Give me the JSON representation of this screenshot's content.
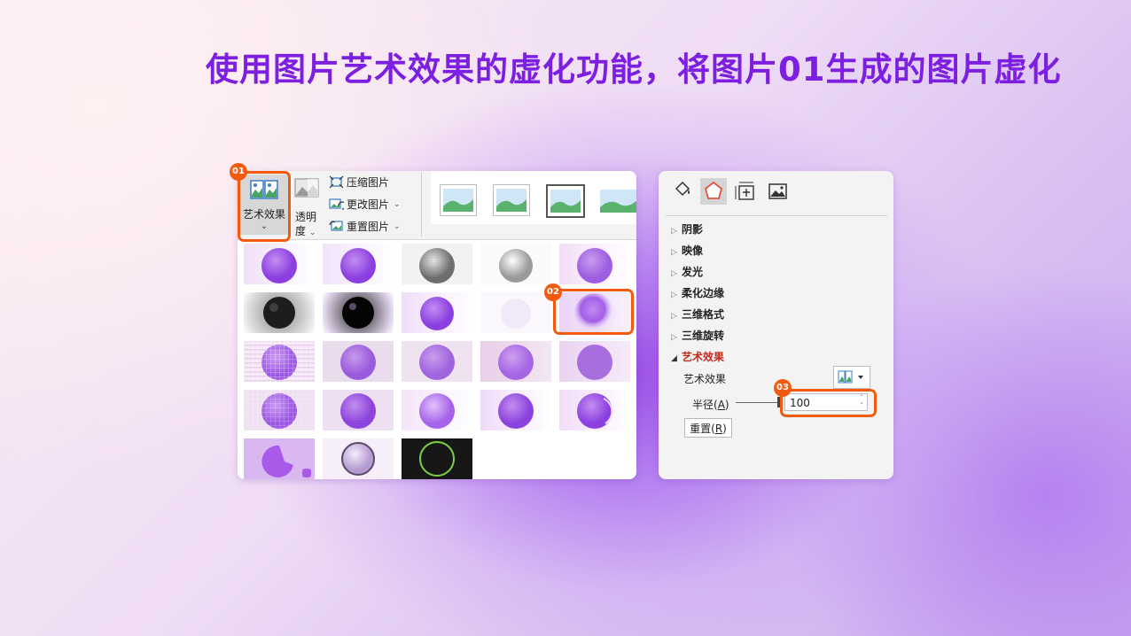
{
  "title": "使用图片艺术效果的虚化功能，将图片01生成的图片虚化",
  "ribbon": {
    "art_effects_label": "艺术效果",
    "transparency_label_1": "透明",
    "transparency_label_2": "度",
    "compress_label": "压缩图片",
    "change_label": "更改图片",
    "reset_pic_label": "重置图片"
  },
  "badges": {
    "step1": "01",
    "step2": "02",
    "step3": "03"
  },
  "format_pane": {
    "items": [
      "阴影",
      "映像",
      "发光",
      "柔化边缘",
      "三维格式",
      "三维旋转"
    ],
    "open_item": "艺术效果",
    "effect_label": "艺术效果",
    "radius_label": "半径(",
    "radius_key": "A",
    "radius_label_end": ")",
    "radius_value": "100",
    "reset_label": "重置(",
    "reset_key": "R",
    "reset_label_end": ")"
  },
  "colors": {
    "accent": "#f15a0f",
    "title": "#7d1fe0",
    "open_item": "#c42b1c"
  }
}
